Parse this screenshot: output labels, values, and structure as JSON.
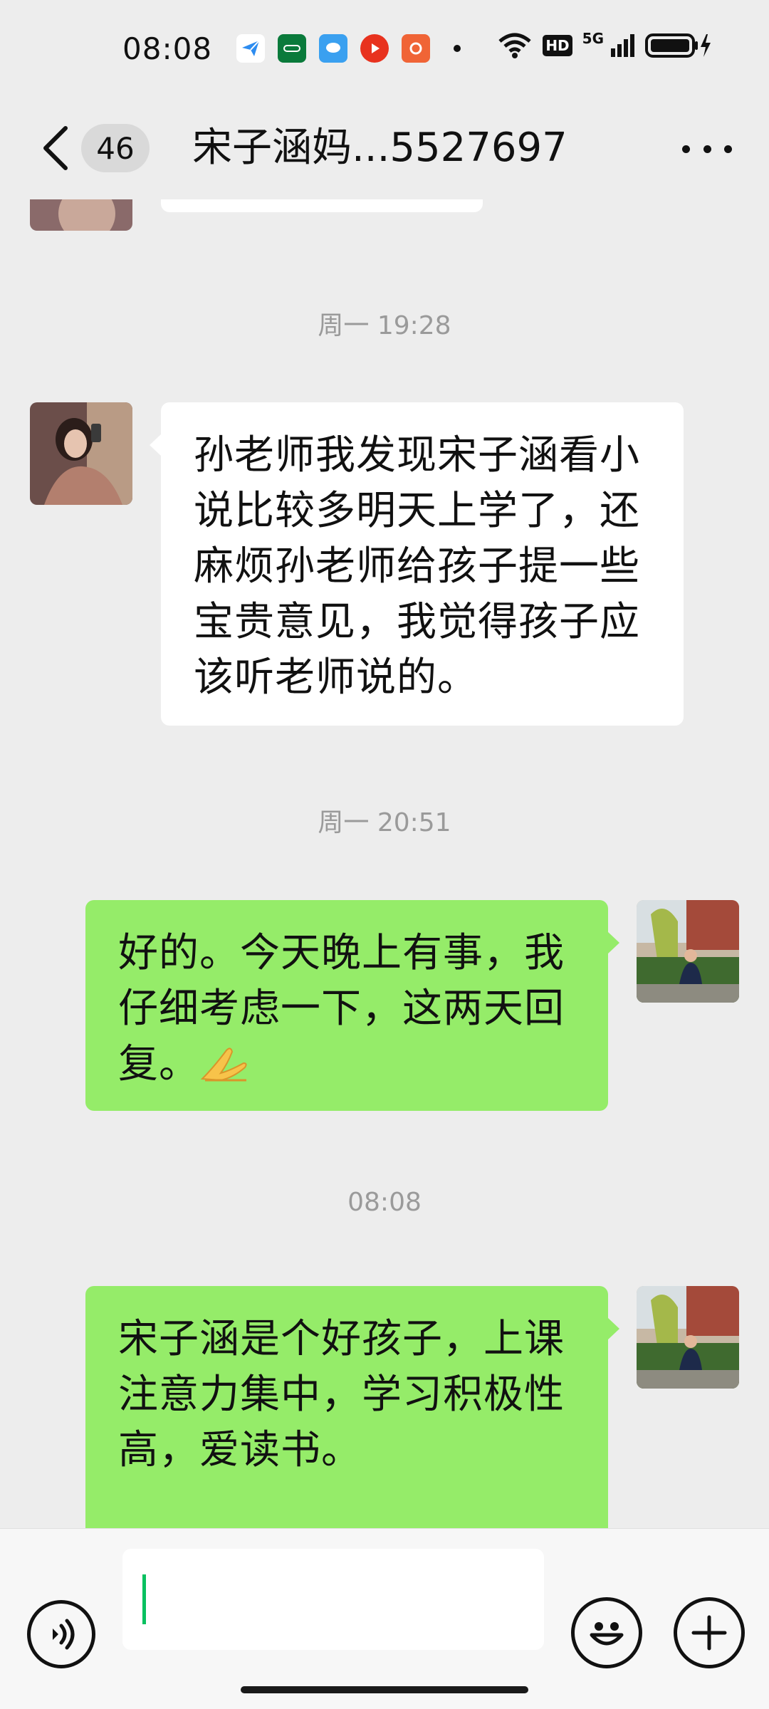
{
  "status_bar": {
    "time": "08:08",
    "hd_label": "HD",
    "network_label": "5G",
    "notification_icons": [
      "paper-plane-icon",
      "oppo-app-icon",
      "chat-bubble-icon",
      "video-play-icon",
      "camera-app-icon",
      "dot-icon"
    ]
  },
  "header": {
    "unread_count": "46",
    "title": "宋子涵妈...5527697"
  },
  "messages": [
    {
      "type": "timestamp",
      "text": "周一 19:28"
    },
    {
      "type": "incoming",
      "text": "孙老师我发现宋子涵看小说比较多明天上学了，还麻烦孙老师给孩子提一些宝贵意见，我觉得孩子应该听老师说的。"
    },
    {
      "type": "timestamp",
      "text": "周一 20:51"
    },
    {
      "type": "outgoing",
      "text": "好的。今天晚上有事，我仔细考虑一下，这两天回复。"
    },
    {
      "type": "timestamp",
      "text": "08:08"
    },
    {
      "type": "outgoing",
      "text": "宋子涵是个好孩子，上课注意力集中，学习积极性高，爱读书。"
    }
  ],
  "colors": {
    "background": "#ededed",
    "incoming_bubble": "#ffffff",
    "outgoing_bubble": "#95ec69",
    "cursor": "#07c160"
  }
}
